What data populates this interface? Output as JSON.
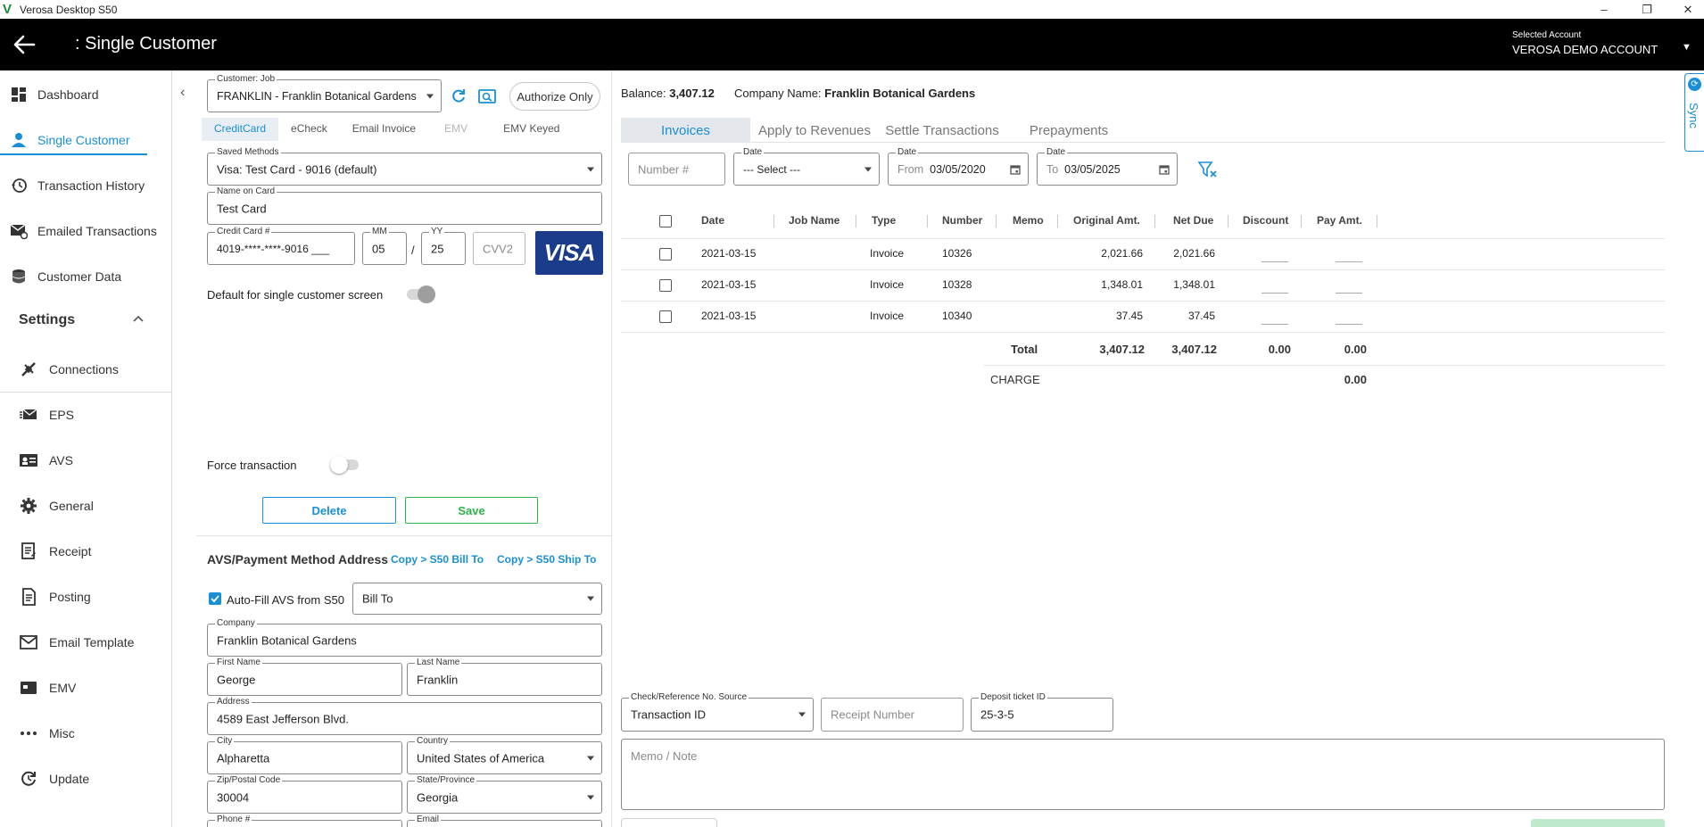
{
  "window": {
    "title": "Verosa Desktop S50",
    "minimize": "–",
    "maximize": "❐",
    "close": "✕"
  },
  "header": {
    "title": ": Single Customer",
    "account_label": "Selected Account",
    "account": "VEROSA DEMO ACCOUNT"
  },
  "sidebar": {
    "items": [
      {
        "label": "Dashboard",
        "icon": "dashboard-icon",
        "active": false
      },
      {
        "label": "Single Customer",
        "icon": "person-icon",
        "active": true
      },
      {
        "label": "Transaction History",
        "icon": "history-icon",
        "active": false
      },
      {
        "label": "Emailed Transactions",
        "icon": "email-icon",
        "active": false
      },
      {
        "label": "Customer Data",
        "icon": "database-icon",
        "active": false
      }
    ],
    "settings_label": "Settings",
    "settings_items": [
      {
        "label": "Connections",
        "icon": "plug-icon"
      },
      {
        "label": "EPS",
        "icon": "mail-forward-icon"
      },
      {
        "label": "AVS",
        "icon": "id-card-icon"
      },
      {
        "label": "General",
        "icon": "gear-icon"
      },
      {
        "label": "Receipt",
        "icon": "receipt-icon"
      },
      {
        "label": "Posting",
        "icon": "posting-icon"
      },
      {
        "label": "Email Template",
        "icon": "email-template-icon"
      },
      {
        "label": "EMV",
        "icon": "card-reader-icon"
      },
      {
        "label": "Misc",
        "icon": "more-icon"
      },
      {
        "label": "Update",
        "icon": "update-icon"
      }
    ]
  },
  "customer": {
    "label": "Customer: Job",
    "value": "FRANKLIN - Franklin Botanical Gardens",
    "authorize_label": "Authorize Only"
  },
  "payment_tabs": [
    {
      "label": "CreditCard",
      "state": "active"
    },
    {
      "label": "eCheck",
      "state": "normal"
    },
    {
      "label": "Email Invoice",
      "state": "normal"
    },
    {
      "label": "EMV",
      "state": "disabled"
    },
    {
      "label": "EMV Keyed",
      "state": "normal"
    }
  ],
  "card": {
    "saved_label": "Saved Methods",
    "saved_value": "Visa: Test Card - 9016 (default)",
    "name_label": "Name on Card",
    "name_value": "Test Card",
    "number_label": "Credit Card #",
    "number_value": "4019-****-****-9016 ___",
    "mm_label": "MM",
    "mm_value": "05",
    "slash": "/",
    "yy_label": "YY",
    "yy_value": "25",
    "cvv_placeholder": "CVV2",
    "brand": "VISA",
    "default_label": "Default for single customer screen",
    "force_label": "Force transaction",
    "delete_label": "Delete",
    "save_label": "Save"
  },
  "avs": {
    "title": "AVS/Payment Method Address",
    "copy_bill": "Copy > S50 Bill To",
    "copy_ship": "Copy > S50 Ship To",
    "autofill_label": "Auto-Fill AVS from S50",
    "autofill_checked": true,
    "address_type": "Bill To",
    "company_label": "Company",
    "company": "Franklin Botanical Gardens",
    "first_label": "First Name",
    "first": "George",
    "last_label": "Last Name",
    "last": "Franklin",
    "address_label": "Address",
    "address": "4589 East Jefferson Blvd.",
    "city_label": "City",
    "city": "Alpharetta",
    "country_label": "Country",
    "country": "United States of America",
    "zip_label": "Zip/Postal Code",
    "zip": "30004",
    "state_label": "State/Province",
    "state": "Georgia",
    "phone_label": "Phone #",
    "email_label": "Email"
  },
  "summary": {
    "balance_label": "Balance:",
    "balance": "3,407.12",
    "company_label": "Company Name:",
    "company": "Franklin Botanical Gardens"
  },
  "tabs": [
    "Invoices",
    "Apply to Revenues",
    "Settle Transactions",
    "Prepayments"
  ],
  "filters": {
    "number_placeholder": "Number #",
    "date_label": "Date",
    "date_select": "--- Select ---",
    "from_prefix": "From",
    "from_date": "03/05/2020",
    "to_prefix": "To",
    "to_date": "03/05/2025"
  },
  "table": {
    "columns": [
      "Date",
      "Job Name",
      "Type",
      "Number",
      "Memo",
      "Original Amt.",
      "Net Due",
      "Discount",
      "Pay Amt."
    ],
    "rows": [
      {
        "date": "2021-03-15",
        "job": "",
        "type": "Invoice",
        "number": "10326",
        "memo": "",
        "original": "2,021.66",
        "net": "2,021.66"
      },
      {
        "date": "2021-03-15",
        "job": "",
        "type": "Invoice",
        "number": "10328",
        "memo": "",
        "original": "1,348.01",
        "net": "1,348.01"
      },
      {
        "date": "2021-03-15",
        "job": "",
        "type": "Invoice",
        "number": "10340",
        "memo": "",
        "original": "37.45",
        "net": "37.45"
      }
    ],
    "total_label": "Total",
    "total_original": "3,407.12",
    "total_net": "3,407.12",
    "total_discount": "0.00",
    "total_pay": "0.00",
    "charge_label": "CHARGE",
    "charge_value": "0.00"
  },
  "bottom": {
    "ref_label": "Check/Reference No. Source",
    "ref_value": "Transaction ID",
    "receipt_placeholder": "Receipt Number",
    "deposit_label": "Deposit ticket ID",
    "deposit_value": "25-3-5",
    "memo_placeholder": "Memo / Note"
  },
  "sync_label": "Sync",
  "colors": {
    "accent": "#1a8fd6",
    "save_green": "#2bb34a",
    "visa_blue": "#1a3c8a",
    "header_bg": "#000000"
  }
}
